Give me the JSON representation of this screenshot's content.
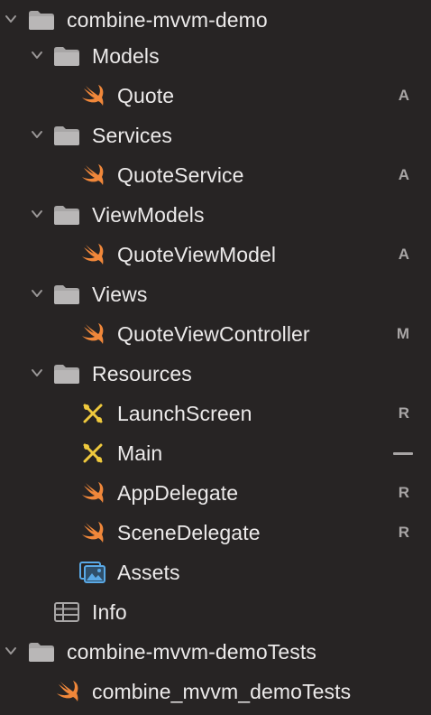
{
  "navigator": {
    "colors": {
      "background": "#272424",
      "text": "#eceaea",
      "badge": "#a8a5a5",
      "folder": "#a8a6a6",
      "swift": "#f0873a",
      "storyboard": "#efc93d",
      "assets": "#5aa9e6"
    },
    "rows": [
      {
        "label": "combine-mvvm-demo",
        "icon": "project-folder-icon",
        "expanded": true,
        "badge": ""
      },
      {
        "label": "Models",
        "icon": "folder-icon",
        "expanded": true,
        "badge": ""
      },
      {
        "label": "Quote",
        "icon": "swift-file-icon",
        "badge": "A"
      },
      {
        "label": "Services",
        "icon": "folder-icon",
        "expanded": true,
        "badge": ""
      },
      {
        "label": "QuoteService",
        "icon": "swift-file-icon",
        "badge": "A"
      },
      {
        "label": "ViewModels",
        "icon": "folder-icon",
        "expanded": true,
        "badge": ""
      },
      {
        "label": "QuoteViewModel",
        "icon": "swift-file-icon",
        "badge": "A"
      },
      {
        "label": "Views",
        "icon": "folder-icon",
        "expanded": true,
        "badge": ""
      },
      {
        "label": "QuoteViewController",
        "icon": "swift-file-icon",
        "badge": "M"
      },
      {
        "label": "Resources",
        "icon": "folder-icon",
        "expanded": true,
        "badge": ""
      },
      {
        "label": "LaunchScreen",
        "icon": "storyboard-icon",
        "badge": "R"
      },
      {
        "label": "Main",
        "icon": "storyboard-icon",
        "badge": "—"
      },
      {
        "label": "AppDelegate",
        "icon": "swift-file-icon",
        "badge": "R"
      },
      {
        "label": "SceneDelegate",
        "icon": "swift-file-icon",
        "badge": "R"
      },
      {
        "label": "Assets",
        "icon": "asset-catalog-icon",
        "badge": ""
      },
      {
        "label": "Info",
        "icon": "plist-table-icon",
        "badge": ""
      },
      {
        "label": "combine-mvvm-demoTests",
        "icon": "project-folder-icon",
        "expanded": true,
        "badge": ""
      },
      {
        "label": "combine_mvvm_demoTests",
        "icon": "swift-file-icon",
        "badge": ""
      }
    ]
  }
}
